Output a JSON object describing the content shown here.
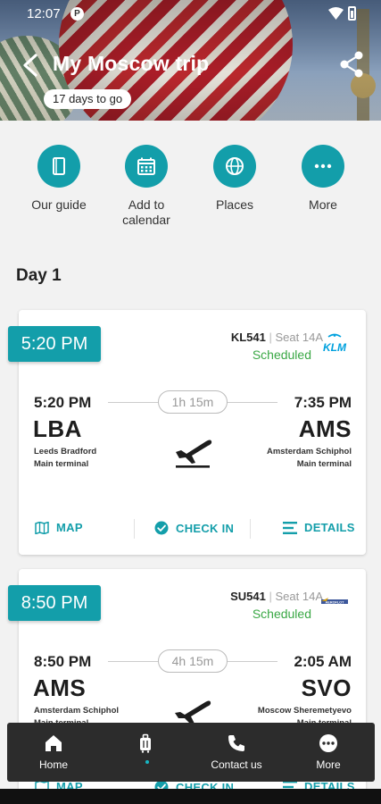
{
  "status_bar": {
    "time": "12:07",
    "app_icon": "P"
  },
  "header": {
    "title": "My Moscow trip",
    "countdown": "17 days to go"
  },
  "quick_actions": [
    {
      "label": "Our guide",
      "icon": "book-icon"
    },
    {
      "label": "Add to calendar",
      "icon": "calendar-icon"
    },
    {
      "label": "Places",
      "icon": "globe-icon"
    },
    {
      "label": "More",
      "icon": "more-dots-icon"
    }
  ],
  "day": {
    "title": "Day 1"
  },
  "flights": [
    {
      "badge_time": "5:20 PM",
      "flight_number": "KL541",
      "seat": "Seat 14A",
      "status": "Scheduled",
      "airline": "KLM",
      "departure": {
        "time": "5:20 PM",
        "code": "LBA",
        "name": "Leeds Bradford",
        "terminal": "Main terminal"
      },
      "arrival": {
        "time": "7:35 PM",
        "code": "AMS",
        "name": "Amsterdam Schiphol",
        "terminal": "Main terminal"
      },
      "duration": "1h 15m",
      "actions": {
        "map": "MAP",
        "checkin": "CHECK IN",
        "details": "DETAILS"
      }
    },
    {
      "badge_time": "8:50 PM",
      "flight_number": "SU541",
      "seat": "Seat 14A",
      "status": "Scheduled",
      "airline": "AEROFLOT",
      "departure": {
        "time": "8:50 PM",
        "code": "AMS",
        "name": "Amsterdam Schiphol",
        "terminal": "Main terminal"
      },
      "arrival": {
        "time": "2:05 AM",
        "code": "SVO",
        "name": "Moscow Sheremetyevo",
        "terminal": "Main terminal"
      },
      "duration": "4h 15m",
      "actions": {
        "map": "MAP",
        "checkin": "CHECK IN",
        "details": "DETAILS"
      }
    }
  ],
  "bottom_nav": [
    {
      "label": "Home",
      "icon": "home-icon"
    },
    {
      "label": "",
      "icon": "luggage-icon",
      "active": true
    },
    {
      "label": "Contact us",
      "icon": "phone-icon"
    },
    {
      "label": "More",
      "icon": "more-icon"
    }
  ],
  "colors": {
    "accent": "#139eaa",
    "scheduled": "#3aa845",
    "nav_background": "#2c2c2c",
    "klm_blue": "#00a1de"
  }
}
